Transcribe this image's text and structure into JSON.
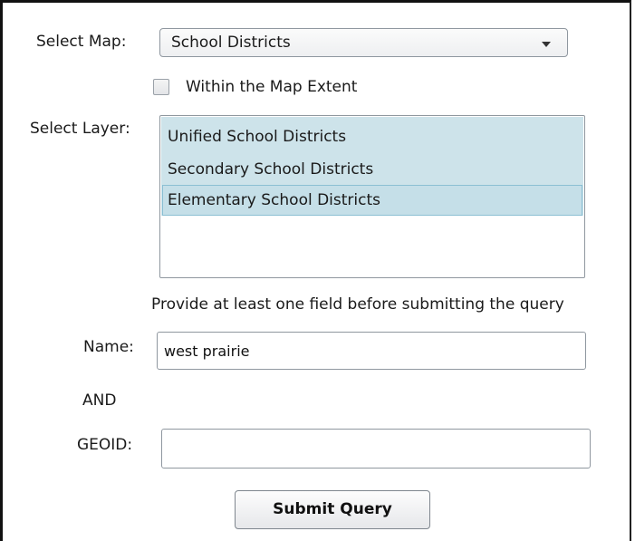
{
  "select_map": {
    "label": "Select Map:",
    "selected_value": "School Districts",
    "arrow_icon": "chevron-down-icon"
  },
  "extent_checkbox": {
    "label": "Within the Map Extent",
    "checked": false
  },
  "select_layer": {
    "label": "Select Layer:",
    "items": [
      "Unified School Districts",
      "Secondary School Districts",
      "Elementary School Districts"
    ],
    "selected_index": 2
  },
  "hint_text": "Provide at least one field before submitting the query",
  "name_field": {
    "label": "Name:",
    "value": "west prairie"
  },
  "operator_text": "AND",
  "geoid_field": {
    "label": "GEOID:",
    "value": ""
  },
  "submit_button": {
    "label": "Submit Query"
  },
  "colors": {
    "list_highlight": "#cde3ea",
    "selected_item": "#c5dfe8",
    "selected_border": "#8bbfd3"
  }
}
